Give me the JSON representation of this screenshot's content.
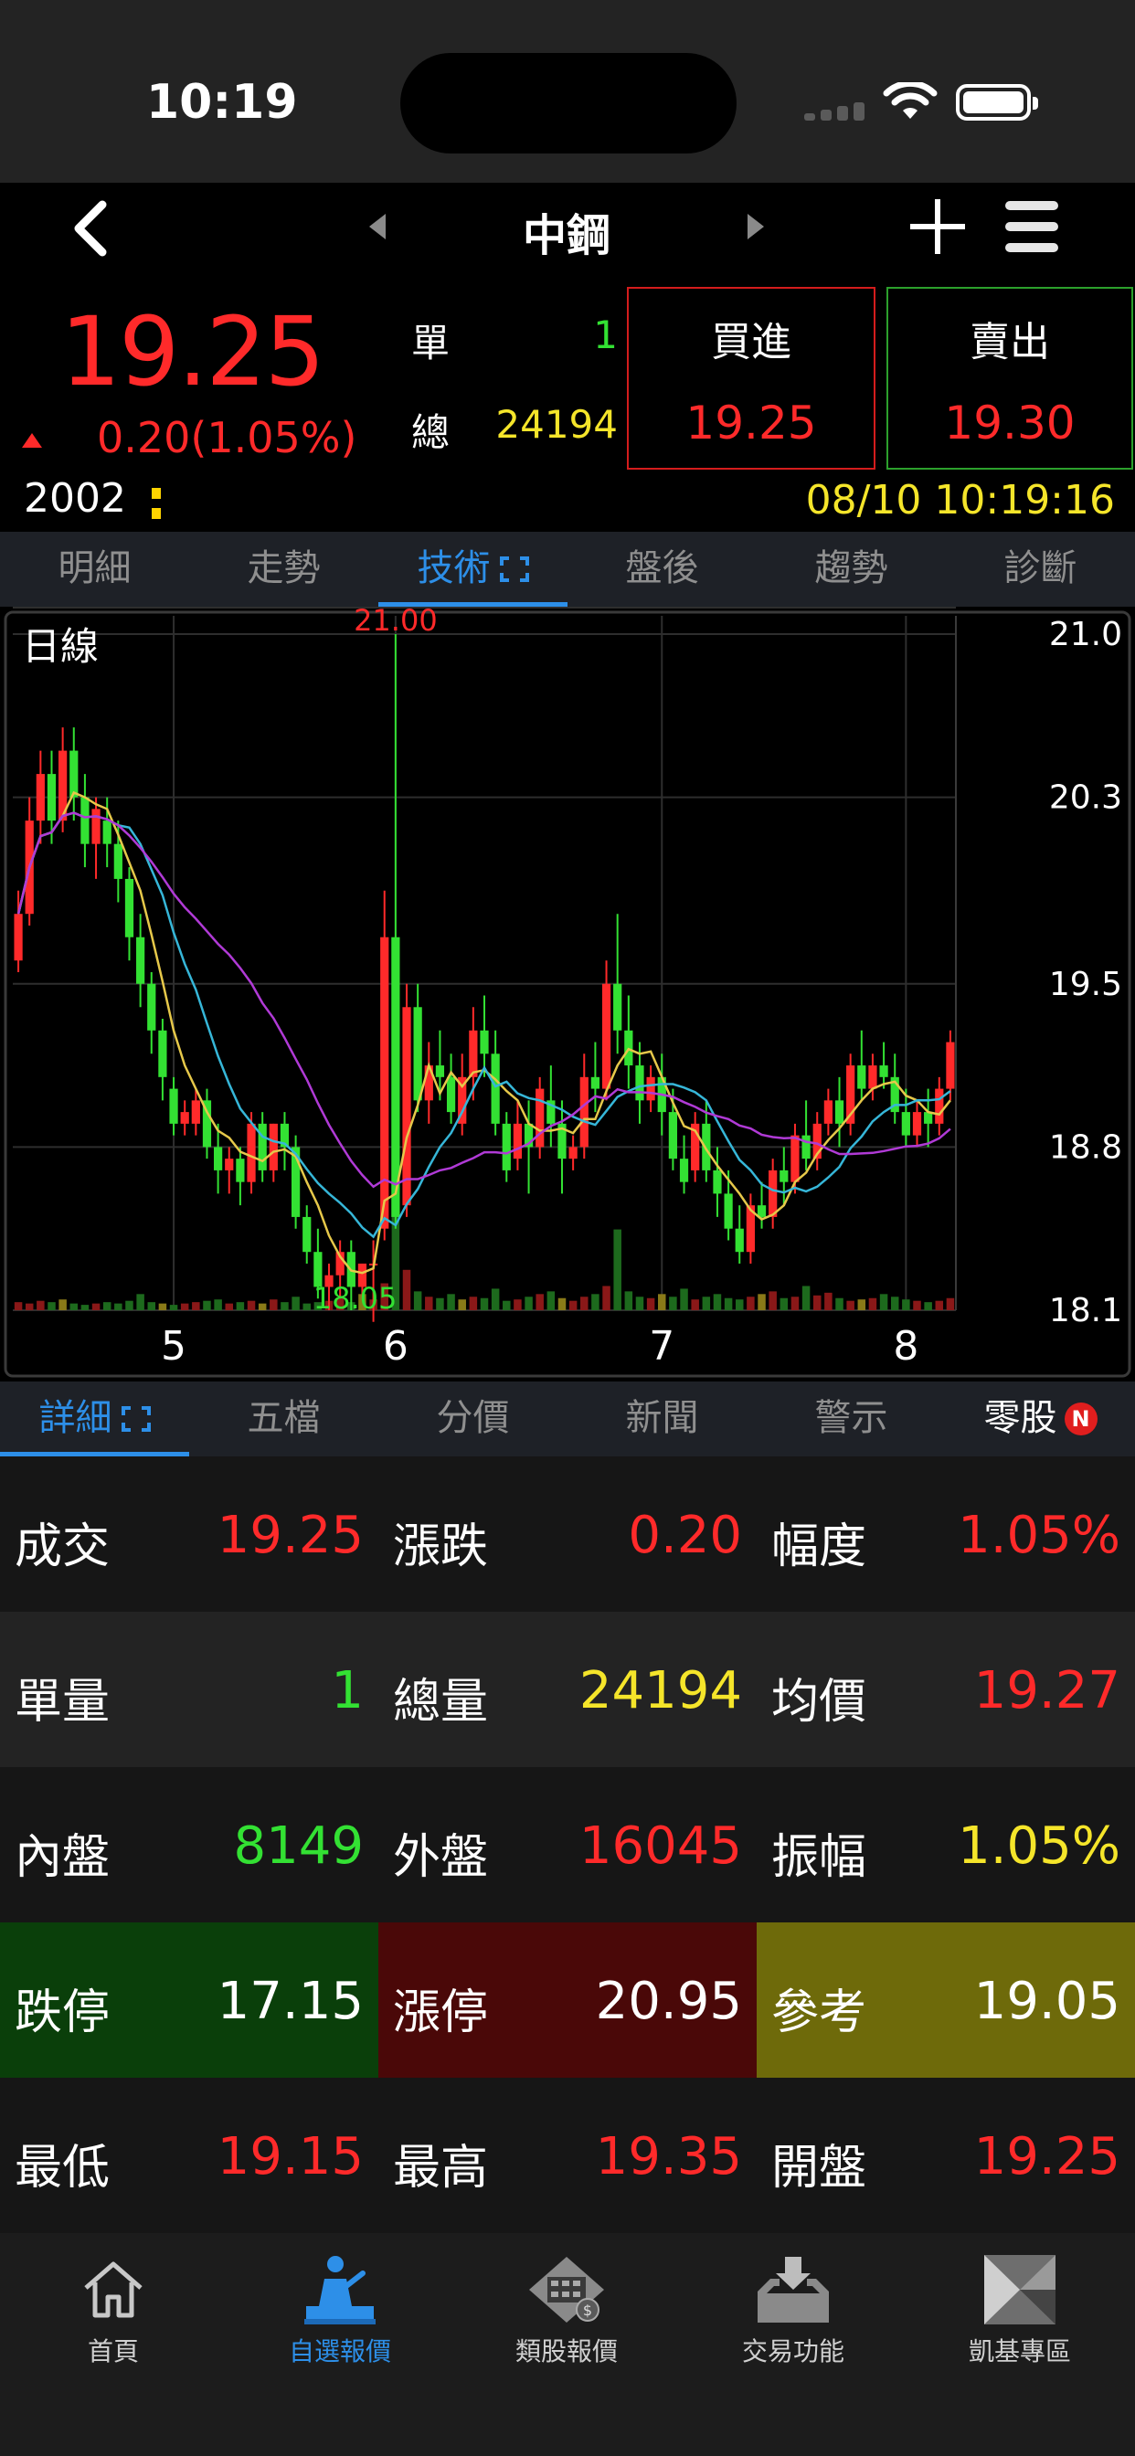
{
  "status_bar": {
    "time": "10:19"
  },
  "nav": {
    "title": "中鋼"
  },
  "quote": {
    "price": "19.25",
    "change": "0.20(1.05%)",
    "code": "2002",
    "single_label": "單",
    "single_value": "1",
    "total_label": "總",
    "total_value": "24194",
    "datetime": "08/10 10:19:16",
    "buy_label": "買進",
    "buy_price": "19.25",
    "sell_label": "賣出",
    "sell_price": "19.30"
  },
  "tabs": [
    {
      "label": "明細"
    },
    {
      "label": "走勢"
    },
    {
      "label": "技術"
    },
    {
      "label": "盤後"
    },
    {
      "label": "趨勢"
    },
    {
      "label": "診斷"
    }
  ],
  "active_tab": 2,
  "chart_data": {
    "type": "candlestick",
    "title": "日線",
    "y_ticks": [
      "21.0",
      "20.3",
      "19.5",
      "18.8",
      "18.1"
    ],
    "ylim": [
      18.1,
      21.0
    ],
    "x_ticks": [
      "5",
      "6",
      "7",
      "8"
    ],
    "high_label": "21.00",
    "low_label": "18.05",
    "candles": [
      [
        19.6,
        19.9,
        19.8,
        19.55
      ],
      [
        19.8,
        20.3,
        20.2,
        19.75
      ],
      [
        20.2,
        20.5,
        20.4,
        20.1
      ],
      [
        20.4,
        20.5,
        20.2,
        20.1
      ],
      [
        20.2,
        20.6,
        20.5,
        20.15
      ],
      [
        20.5,
        20.6,
        20.3,
        20.2
      ],
      [
        20.3,
        20.4,
        20.1,
        20.0
      ],
      [
        20.1,
        20.3,
        20.25,
        19.95
      ],
      [
        20.2,
        20.3,
        20.1,
        20.0
      ],
      [
        20.1,
        20.2,
        19.95,
        19.85
      ],
      [
        19.95,
        20.0,
        19.7,
        19.6
      ],
      [
        19.7,
        19.8,
        19.5,
        19.4
      ],
      [
        19.5,
        19.55,
        19.3,
        19.2
      ],
      [
        19.3,
        19.35,
        19.1,
        19.0
      ],
      [
        19.05,
        19.1,
        18.9,
        18.85
      ],
      [
        18.9,
        19.0,
        18.95,
        18.85
      ],
      [
        18.9,
        19.05,
        19.0,
        18.85
      ],
      [
        19.0,
        19.05,
        18.8,
        18.75
      ],
      [
        18.8,
        18.9,
        18.7,
        18.6
      ],
      [
        18.7,
        18.8,
        18.75,
        18.6
      ],
      [
        18.75,
        18.8,
        18.65,
        18.55
      ],
      [
        18.65,
        18.95,
        18.9,
        18.6
      ],
      [
        18.9,
        18.95,
        18.7,
        18.65
      ],
      [
        18.7,
        18.9,
        18.9,
        18.65
      ],
      [
        18.9,
        18.95,
        18.8,
        18.7
      ],
      [
        18.8,
        18.85,
        18.5,
        18.45
      ],
      [
        18.5,
        18.55,
        18.35,
        18.3
      ],
      [
        18.35,
        18.45,
        18.2,
        18.15
      ],
      [
        18.2,
        18.3,
        18.25,
        18.1
      ],
      [
        18.25,
        18.4,
        18.35,
        18.15
      ],
      [
        18.35,
        18.4,
        18.2,
        18.1
      ],
      [
        18.2,
        18.3,
        18.3,
        18.15
      ],
      [
        18.3,
        18.4,
        18.3,
        18.05
      ],
      [
        18.45,
        19.9,
        19.7,
        18.4
      ],
      [
        19.7,
        21.0,
        18.5,
        18.45
      ],
      [
        18.55,
        19.5,
        19.4,
        18.5
      ],
      [
        19.4,
        19.5,
        19.0,
        18.95
      ],
      [
        19.0,
        19.25,
        19.15,
        18.9
      ],
      [
        19.15,
        19.3,
        19.1,
        19.0
      ],
      [
        19.1,
        19.2,
        18.95,
        18.9
      ],
      [
        18.9,
        19.2,
        19.1,
        18.85
      ],
      [
        19.1,
        19.4,
        19.3,
        19.0
      ],
      [
        19.3,
        19.45,
        19.2,
        19.1
      ],
      [
        19.2,
        19.3,
        18.9,
        18.85
      ],
      [
        18.9,
        18.95,
        18.7,
        18.65
      ],
      [
        18.75,
        19.0,
        18.9,
        18.7
      ],
      [
        18.9,
        19.0,
        18.8,
        18.6
      ],
      [
        18.8,
        19.1,
        19.05,
        18.75
      ],
      [
        19.0,
        19.15,
        18.9,
        18.8
      ],
      [
        18.9,
        19.0,
        18.75,
        18.6
      ],
      [
        18.75,
        18.85,
        18.8,
        18.7
      ],
      [
        18.8,
        19.2,
        19.1,
        18.75
      ],
      [
        19.1,
        19.25,
        19.05,
        18.95
      ],
      [
        19.05,
        19.6,
        19.5,
        19.0
      ],
      [
        19.5,
        19.8,
        19.3,
        19.2
      ],
      [
        19.3,
        19.45,
        19.15,
        19.05
      ],
      [
        19.15,
        19.25,
        19.0,
        18.9
      ],
      [
        19.0,
        19.15,
        19.1,
        18.95
      ],
      [
        19.1,
        19.2,
        18.95,
        18.85
      ],
      [
        18.95,
        19.05,
        18.75,
        18.7
      ],
      [
        18.75,
        18.85,
        18.65,
        18.6
      ],
      [
        18.7,
        18.95,
        18.9,
        18.65
      ],
      [
        18.9,
        19.0,
        18.7,
        18.65
      ],
      [
        18.7,
        18.8,
        18.6,
        18.5
      ],
      [
        18.6,
        18.7,
        18.45,
        18.4
      ],
      [
        18.45,
        18.55,
        18.35,
        18.3
      ],
      [
        18.35,
        18.6,
        18.55,
        18.3
      ],
      [
        18.55,
        18.65,
        18.5,
        18.45
      ],
      [
        18.5,
        18.75,
        18.7,
        18.45
      ],
      [
        18.7,
        18.8,
        18.65,
        18.55
      ],
      [
        18.65,
        18.9,
        18.85,
        18.6
      ],
      [
        18.85,
        19.0,
        18.75,
        18.7
      ],
      [
        18.75,
        18.95,
        18.9,
        18.7
      ],
      [
        18.9,
        19.05,
        19.0,
        18.85
      ],
      [
        19.0,
        19.1,
        18.9,
        18.8
      ],
      [
        18.9,
        19.2,
        19.15,
        18.85
      ],
      [
        19.15,
        19.3,
        19.05,
        19.0
      ],
      [
        19.05,
        19.2,
        19.15,
        19.0
      ],
      [
        19.15,
        19.25,
        19.1,
        19.05
      ],
      [
        19.1,
        19.2,
        18.95,
        18.9
      ],
      [
        18.95,
        19.05,
        18.85,
        18.8
      ],
      [
        18.85,
        19.0,
        18.95,
        18.8
      ],
      [
        18.95,
        19.05,
        18.9,
        18.8
      ],
      [
        18.9,
        19.1,
        19.05,
        18.85
      ],
      [
        19.05,
        19.3,
        19.25,
        19.0
      ]
    ],
    "volume": [
      6,
      5,
      7,
      6,
      8,
      5,
      4,
      5,
      6,
      5,
      7,
      12,
      6,
      5,
      4,
      5,
      6,
      7,
      8,
      5,
      6,
      7,
      5,
      8,
      6,
      10,
      5,
      6,
      7,
      9,
      6,
      12,
      8,
      20,
      95,
      30,
      14,
      10,
      9,
      12,
      8,
      10,
      9,
      16,
      7,
      8,
      10,
      12,
      14,
      9,
      7,
      10,
      12,
      18,
      60,
      14,
      10,
      9,
      12,
      10,
      16,
      8,
      10,
      12,
      9,
      8,
      10,
      12,
      14,
      9,
      10,
      18,
      11,
      13,
      9,
      7,
      8,
      9,
      12,
      10,
      8,
      7,
      6,
      7,
      9
    ],
    "ma_lines": [
      {
        "color": "#e6c84a"
      },
      {
        "color": "#36b6d8"
      },
      {
        "color": "#b03ad6"
      }
    ]
  },
  "sub_tabs": [
    {
      "label": "詳細"
    },
    {
      "label": "五檔"
    },
    {
      "label": "分價"
    },
    {
      "label": "新聞"
    },
    {
      "label": "警示"
    },
    {
      "label": "零股",
      "badge": "N"
    }
  ],
  "active_sub_tab": 0,
  "detail": [
    [
      {
        "label": "成交",
        "value": "19.25",
        "color": "red"
      },
      {
        "label": "漲跌",
        "value": "0.20",
        "color": "red"
      },
      {
        "label": "幅度",
        "value": "1.05%",
        "color": "red"
      }
    ],
    [
      {
        "label": "單量",
        "value": "1",
        "color": "green"
      },
      {
        "label": "總量",
        "value": "24194",
        "color": "yellow"
      },
      {
        "label": "均價",
        "value": "19.27",
        "color": "red"
      }
    ],
    [
      {
        "label": "內盤",
        "value": "8149",
        "color": "green"
      },
      {
        "label": "外盤",
        "value": "16045",
        "color": "red"
      },
      {
        "label": "振幅",
        "value": "1.05%",
        "color": "yellow"
      }
    ],
    [
      {
        "label": "跌停",
        "value": "17.15",
        "color": "white",
        "bg": "limit-down"
      },
      {
        "label": "漲停",
        "value": "20.95",
        "color": "white",
        "bg": "limit-up"
      },
      {
        "label": "參考",
        "value": "19.05",
        "color": "white",
        "bg": "ref"
      }
    ],
    [
      {
        "label": "最低",
        "value": "19.15",
        "color": "red"
      },
      {
        "label": "最高",
        "value": "19.35",
        "color": "red"
      },
      {
        "label": "開盤",
        "value": "19.25",
        "color": "red"
      }
    ]
  ],
  "bottom_nav": [
    {
      "label": "首頁",
      "icon": "home-icon"
    },
    {
      "label": "自選報價",
      "icon": "watchlist-icon"
    },
    {
      "label": "類股報價",
      "icon": "sector-icon"
    },
    {
      "label": "交易功能",
      "icon": "trade-icon"
    },
    {
      "label": "凱基專區",
      "icon": "kgi-icon"
    }
  ],
  "active_bottom": 1,
  "colors": {
    "up": "#ff2a2a",
    "down": "#33e133",
    "accent": "#2d8fe8",
    "highlight": "#f5e52a"
  }
}
